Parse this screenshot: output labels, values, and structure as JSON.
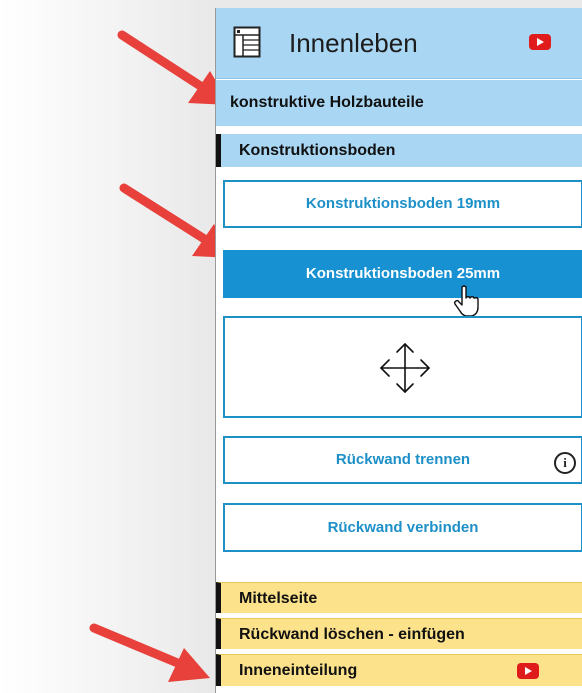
{
  "header": {
    "title": "Innenleben",
    "doc_icon": "document-table-icon",
    "video_icon": "youtube-icon"
  },
  "sections": {
    "konstruktive": "konstruktive Holzbauteile",
    "konstruktionsboden": "Konstruktionsboden"
  },
  "buttons": {
    "boden19": "Konstruktionsboden 19mm",
    "boden25": "Konstruktionsboden 25mm",
    "move_icon": "move-arrows-icon",
    "rueckwand_trennen": "Rückwand trennen",
    "rueckwand_verbinden": "Rückwand verbinden",
    "info_icon": "i"
  },
  "yellow_items": {
    "mittelseite": "Mittelseite",
    "rueckwand_loeschen": "Rückwand löschen - einfügen",
    "inneneinteilung": "Inneneinteilung"
  },
  "colors": {
    "header_blue": "#a8d6f3",
    "accent_blue": "#1791d2",
    "yellow": "#fce28a",
    "arrow_red": "#e8403a",
    "youtube_red": "#e01b1b"
  }
}
